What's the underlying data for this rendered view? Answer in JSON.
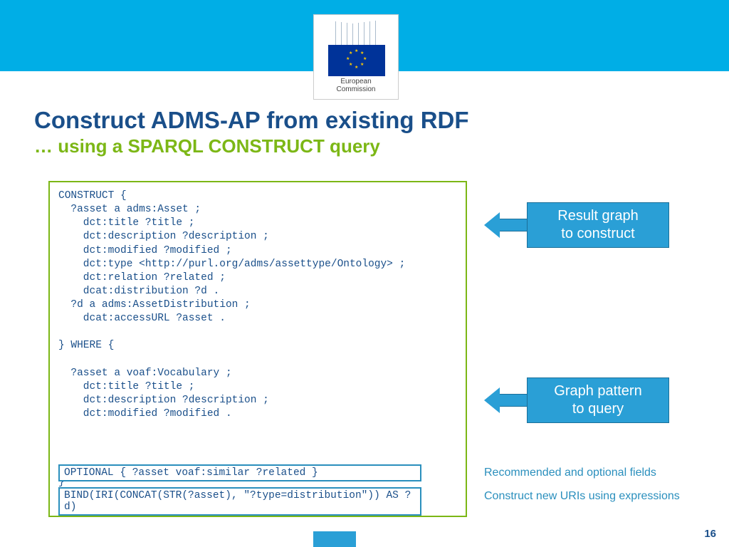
{
  "logo": {
    "caption_line1": "European",
    "caption_line2": "Commission"
  },
  "title": {
    "main": "Construct ADMS-AP from existing RDF",
    "sub": "… using a SPARQL CONSTRUCT query"
  },
  "code": "CONSTRUCT {\n  ?asset a adms:Asset ;\n    dct:title ?title ;\n    dct:description ?description ;\n    dct:modified ?modified ;\n    dct:type <http://purl.org/adms/assettype/Ontology> ;\n    dct:relation ?related ;\n    dcat:distribution ?d .\n  ?d a adms:AssetDistribution ;\n    dcat:accessURL ?asset .\n\n} WHERE {\n\n  ?asset a voaf:Vocabulary ;\n    dct:title ?title ;\n    dct:description ?description ;\n    dct:modified ?modified .\n\n\n\n\n}",
  "optional_line": "OPTIONAL { ?asset voaf:similar ?related }",
  "bind_line": "BIND(IRI(CONCAT(STR(?asset), \"?type=distribution\")) AS ?d)",
  "callouts": {
    "result_l1": "Result graph",
    "result_l2": "to construct",
    "pattern_l1": "Graph pattern",
    "pattern_l2": "to query"
  },
  "notes": {
    "recommended": "Recommended and optional fields",
    "construct": "Construct new URIs using expressions"
  },
  "page_number": "16"
}
